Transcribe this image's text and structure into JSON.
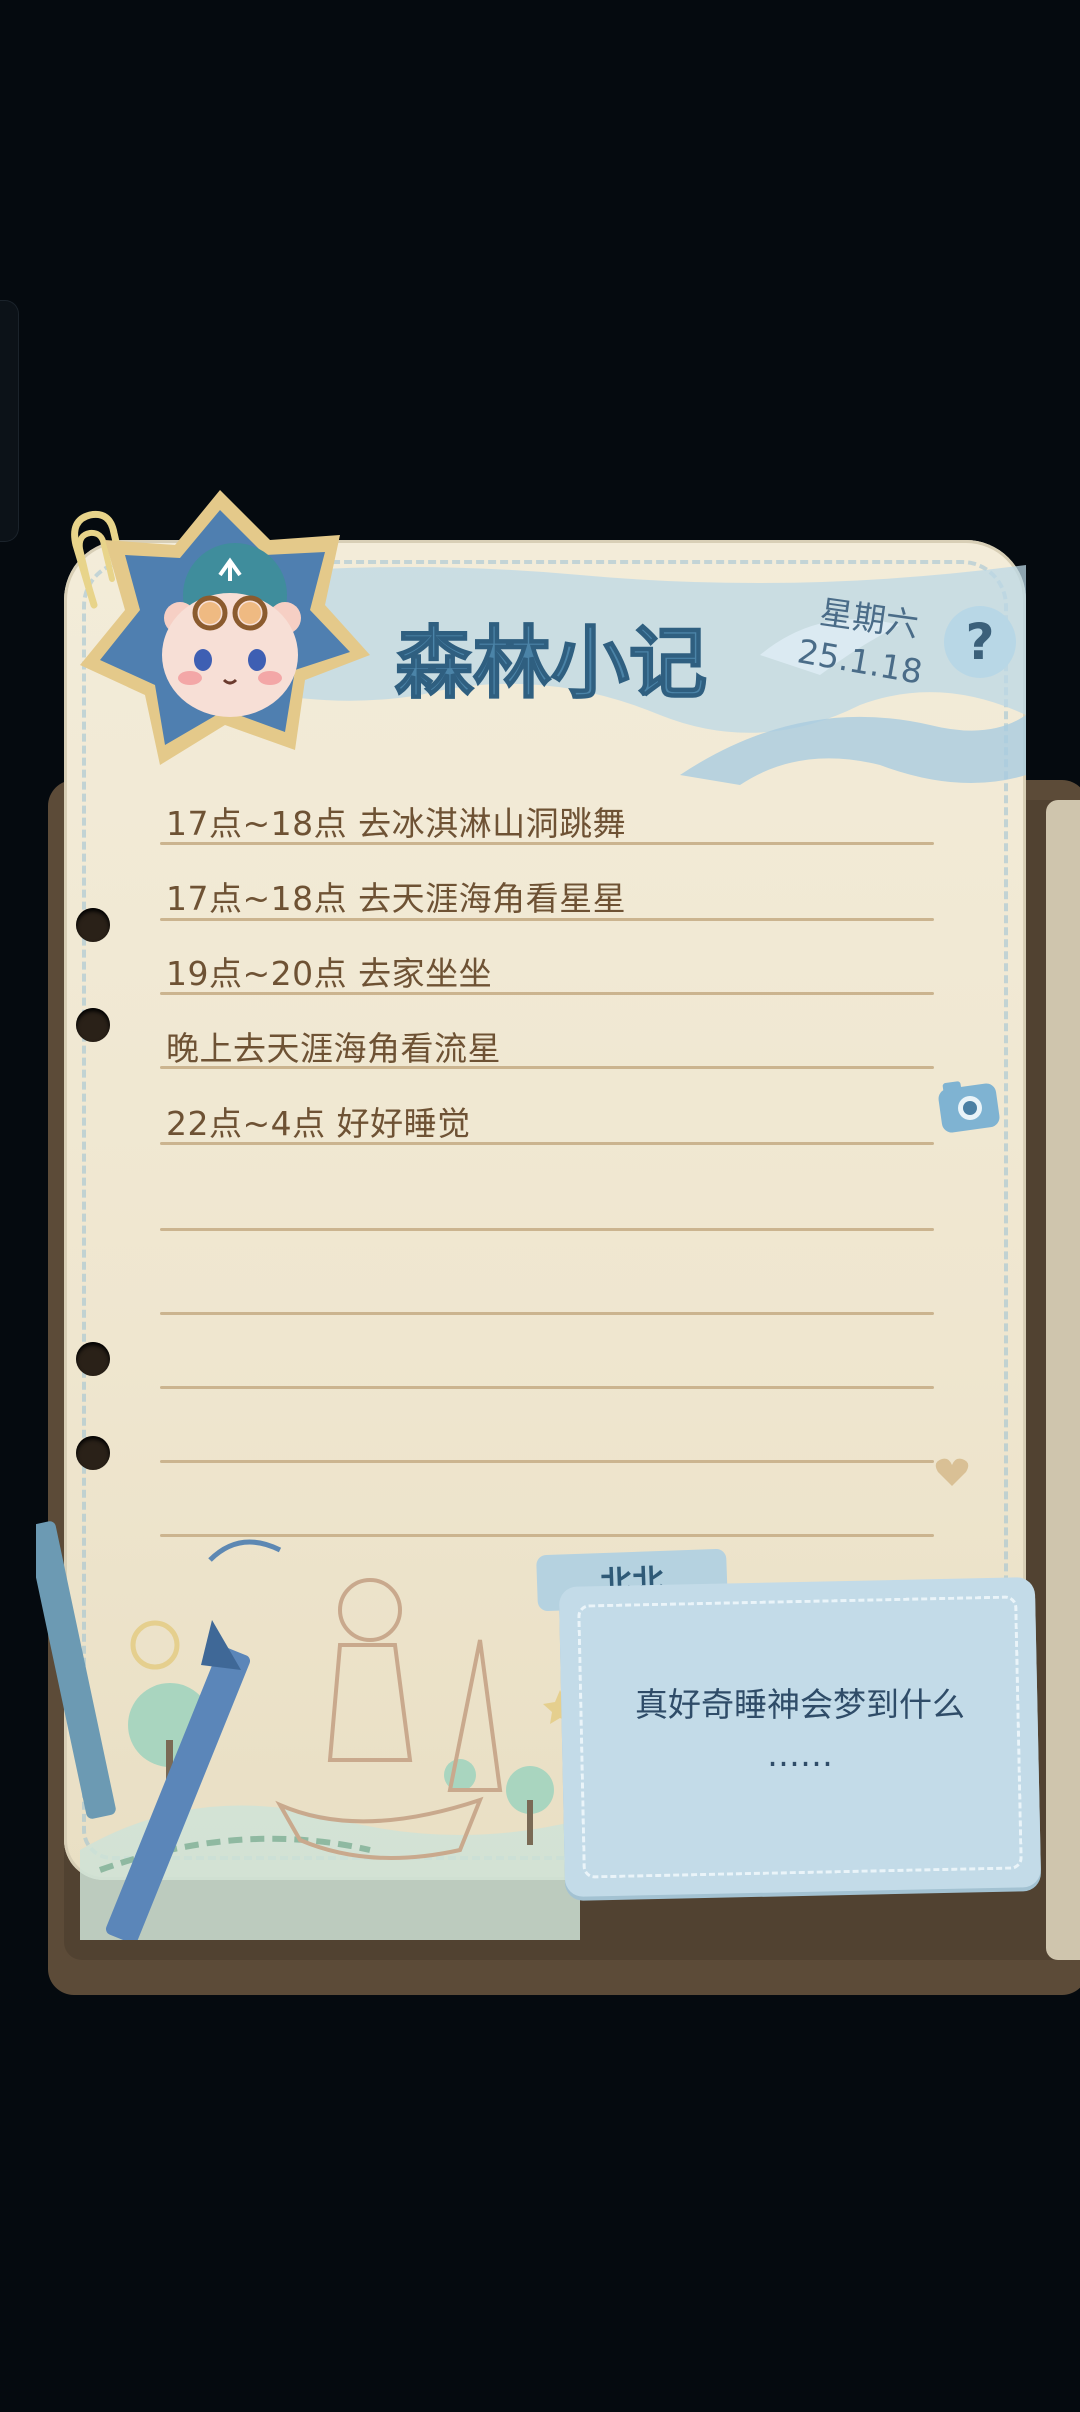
{
  "journal": {
    "title": "森林小记",
    "weekday": "星期六",
    "date": "25.1.18",
    "help_label": "?",
    "entries": [
      "17点~18点 去冰淇淋山洞跳舞",
      "17点~18点 去天涯海角看星星",
      "19点~20点 去家坐坐",
      "晚上去天涯海角看流星",
      "22点~4点 好好睡觉"
    ]
  },
  "dialog": {
    "speaker": "北北",
    "line1": "真好奇睡神会梦到什么",
    "line2": "……"
  },
  "colors": {
    "background": "#050a0f",
    "paper": "#efe6cf",
    "ink": "#6e5234",
    "accent_blue": "#4a6c88",
    "card": "#c3dbe8"
  },
  "icons": [
    "bear-avatar-icon",
    "paperclip-icon",
    "help-icon",
    "camera-icon",
    "heart-icon",
    "pencil-icon"
  ]
}
